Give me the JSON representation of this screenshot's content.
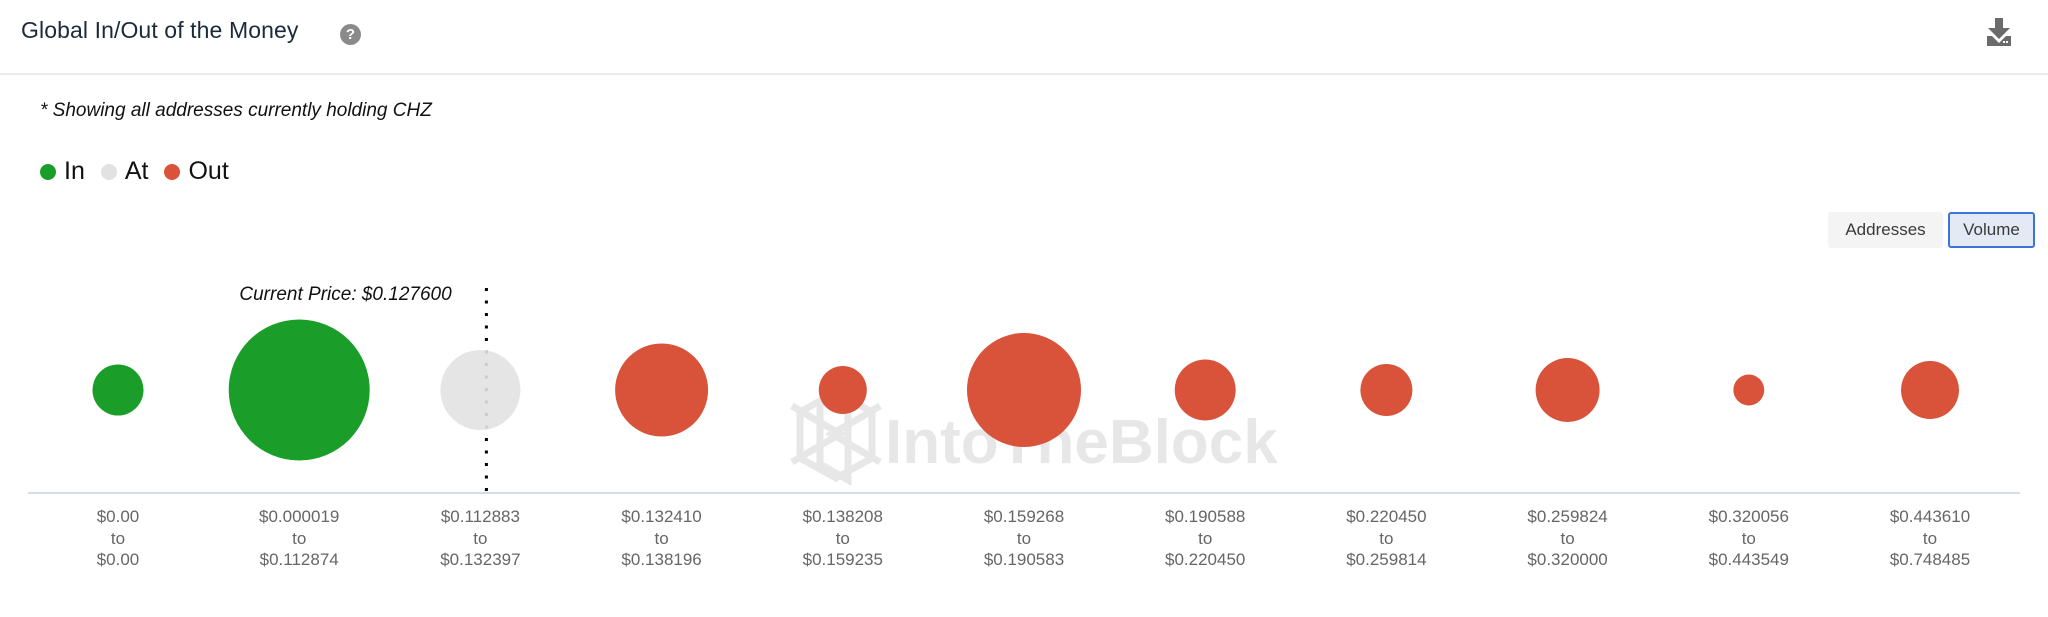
{
  "header": {
    "title": "Global In/Out of the Money",
    "help_icon": "question-circle-icon",
    "download_icon": "download-icon"
  },
  "subtitle": "* Showing all addresses currently holding CHZ",
  "legend": [
    {
      "label": "In",
      "color": "#1a9e29"
    },
    {
      "label": "At",
      "color": "#e2e2e2"
    },
    {
      "label": "Out",
      "color": "#d9523a"
    }
  ],
  "toggles": {
    "addresses_label": "Addresses",
    "volume_label": "Volume",
    "active": "Volume"
  },
  "watermark": "IntoTheBlock",
  "chart_data": {
    "type": "scatter",
    "subtype": "bubble",
    "title": "Global In/Out of the Money",
    "xlabel": "",
    "ylabel": "",
    "size_metric": "Volume (relative, largest = 100; estimated from bubble area)",
    "current_price_label": "Current Price: $0.127600",
    "current_price": 0.1276,
    "current_price_bucket_index": 2,
    "grid": false,
    "legend_position": "top-left",
    "categories": [
      {
        "from": "$0.00",
        "to": "$0.00"
      },
      {
        "from": "$0.000019",
        "to": "$0.112874"
      },
      {
        "from": "$0.112883",
        "to": "$0.132397"
      },
      {
        "from": "$0.132410",
        "to": "$0.138196"
      },
      {
        "from": "$0.138208",
        "to": "$0.159235"
      },
      {
        "from": "$0.159268",
        "to": "$0.190583"
      },
      {
        "from": "$0.190588",
        "to": "$0.220450"
      },
      {
        "from": "$0.220450",
        "to": "$0.259814"
      },
      {
        "from": "$0.259824",
        "to": "$0.320000"
      },
      {
        "from": "$0.320056",
        "to": "$0.443549"
      },
      {
        "from": "$0.443610",
        "to": "$0.748485"
      }
    ],
    "connector_word": "to",
    "points": [
      {
        "status": "In",
        "value": 13.1
      },
      {
        "status": "In",
        "value": 100
      },
      {
        "status": "At",
        "value": 32.2
      },
      {
        "status": "Out",
        "value": 43.5
      },
      {
        "status": "Out",
        "value": 11.6
      },
      {
        "status": "Out",
        "value": 65.4
      },
      {
        "status": "Out",
        "value": 18.7
      },
      {
        "status": "Out",
        "value": 13.6
      },
      {
        "status": "Out",
        "value": 20.6
      },
      {
        "status": "Out",
        "value": 4.8
      },
      {
        "status": "Out",
        "value": 16.9
      }
    ],
    "status_colors": {
      "In": "#1a9e29",
      "At": "#e2e2e2",
      "Out": "#d9523a"
    }
  }
}
